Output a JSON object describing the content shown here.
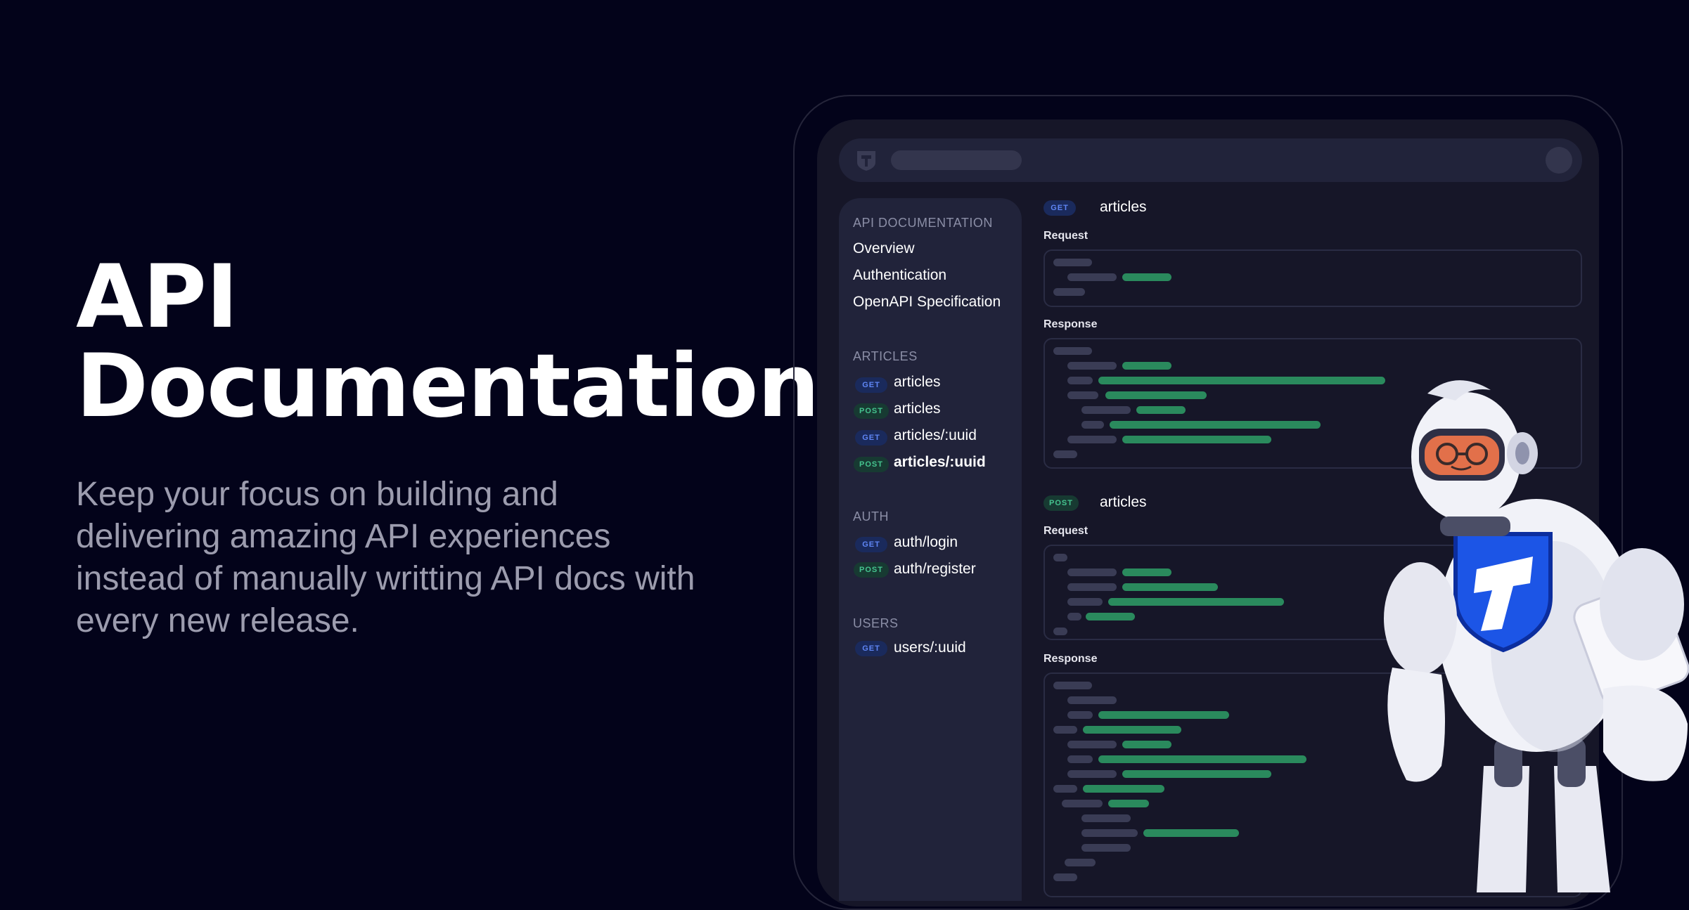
{
  "hero": {
    "title": "API Documentation",
    "subtitle": "Keep your focus on building and delivering amazing API experiences instead of manually writting API docs with every new release."
  },
  "topbar": {
    "logo_icon": "t-shield-logo-icon",
    "search_icon": "search-bar-placeholder",
    "avatar_icon": "avatar-icon"
  },
  "sidebar": {
    "sections": [
      {
        "title": "API DOCUMENTATION",
        "items": [
          {
            "label": "Overview"
          },
          {
            "label": "Authentication"
          },
          {
            "label": "OpenAPI Specification"
          }
        ]
      },
      {
        "title": "ARTICLES",
        "items": [
          {
            "method": "GET",
            "label": "articles"
          },
          {
            "method": "POST",
            "label": "articles"
          },
          {
            "method": "GET",
            "label": "articles/:uuid"
          },
          {
            "method": "POST",
            "label": "articles/:uuid"
          }
        ]
      },
      {
        "title": "AUTH",
        "items": [
          {
            "method": "GET",
            "label": "auth/login"
          },
          {
            "method": "POST",
            "label": "auth/register"
          }
        ]
      },
      {
        "title": "USERS",
        "items": [
          {
            "method": "GET",
            "label": "users/:uuid"
          }
        ]
      }
    ]
  },
  "endpoints": [
    {
      "method": "GET",
      "name": "articles",
      "request_label": "Request",
      "response_label": "Response"
    },
    {
      "method": "POST",
      "name": "articles",
      "request_label": "Request",
      "response_label": "Response"
    }
  ],
  "colors": {
    "background": "#03031a",
    "get": "#5f86f5",
    "post": "#45c48f",
    "code_accent": "#2a8a5d"
  },
  "illustration": "robot-astronaut-mascot"
}
